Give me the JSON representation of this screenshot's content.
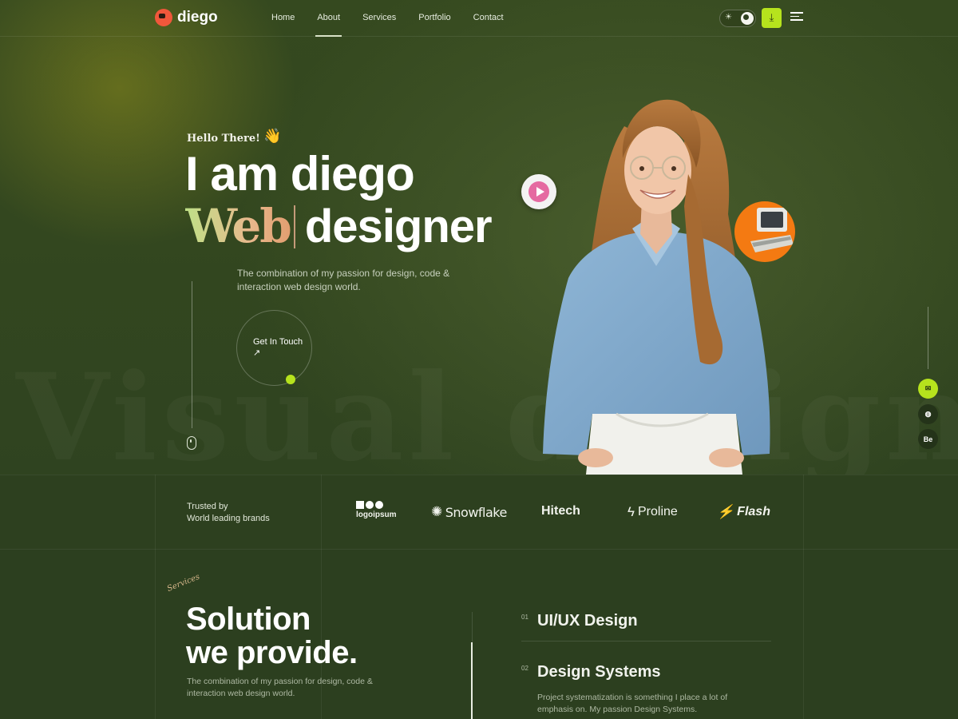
{
  "nav": {
    "logo_text": "diego",
    "links": [
      {
        "label": "Home"
      },
      {
        "label": "About",
        "active": true
      },
      {
        "label": "Services"
      },
      {
        "label": "Portfolio"
      },
      {
        "label": "Contact"
      }
    ]
  },
  "hero": {
    "greeting": "Hello There!",
    "title_line1": "I am diego",
    "title_accent": "Web",
    "title_rest": "designer",
    "description": "The combination of my passion for design, code & interaction web design world.",
    "cta_label": "Get In Touch ↗",
    "background_word": "Visual designer"
  },
  "social": {
    "behance_label": "Be"
  },
  "brands": {
    "trusted_line1": "Trusted by",
    "trusted_line2": "World leading brands",
    "items": [
      {
        "name": "logoipsum"
      },
      {
        "name": "Snowflake"
      },
      {
        "name": "Hitech"
      },
      {
        "name": "Proline"
      },
      {
        "name": "Flash"
      }
    ]
  },
  "services": {
    "tag": "Services",
    "title_line1": "Solution",
    "title_line2": "we provide.",
    "description": "The combination of my passion for design, code & interaction web design world.",
    "items": [
      {
        "number": "01",
        "name": "UI/UX Design",
        "text": ""
      },
      {
        "number": "02",
        "name": "Design Systems",
        "text": "Project systematization is something I place a lot of emphasis on. My passion Design Systems."
      }
    ]
  },
  "colors": {
    "accent": "#b6e31d",
    "background": "#2c3f20",
    "web_gradient_start": "#bfe087",
    "web_gradient_end": "#e29e70",
    "badge_orange": "#f47a12",
    "play_pink": "#e56aa1"
  }
}
